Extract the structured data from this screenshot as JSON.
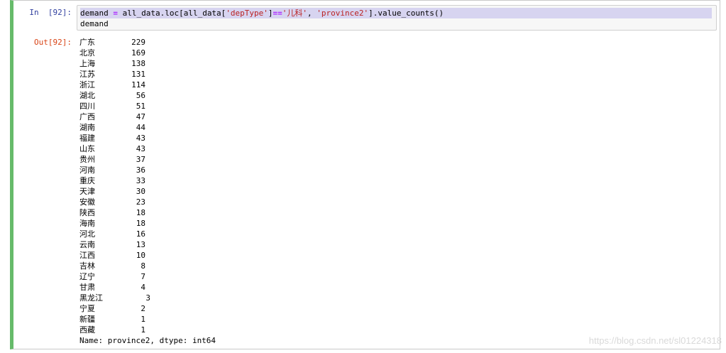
{
  "cell": {
    "in_prompt": "In  [92]:",
    "out_prompt": "Out[92]:",
    "code": {
      "line1_parts": [
        "demand ",
        "=",
        " all_data.loc[all_data[",
        "'depType'",
        "]",
        "==",
        "'儿科'",
        ", ",
        "'province2'",
        "].value_counts()"
      ],
      "line2": "demand"
    },
    "output": {
      "rows": [
        {
          "label": "广东",
          "count": "229"
        },
        {
          "label": "北京",
          "count": "169"
        },
        {
          "label": "上海",
          "count": "138"
        },
        {
          "label": "江苏",
          "count": "131"
        },
        {
          "label": "浙江",
          "count": "114"
        },
        {
          "label": "湖北",
          "count": "56"
        },
        {
          "label": "四川",
          "count": "51"
        },
        {
          "label": "广西",
          "count": "47"
        },
        {
          "label": "湖南",
          "count": "44"
        },
        {
          "label": "福建",
          "count": "43"
        },
        {
          "label": "山东",
          "count": "43"
        },
        {
          "label": "贵州",
          "count": "37"
        },
        {
          "label": "河南",
          "count": "36"
        },
        {
          "label": "重庆",
          "count": "33"
        },
        {
          "label": "天津",
          "count": "30"
        },
        {
          "label": "安徽",
          "count": "23"
        },
        {
          "label": "陕西",
          "count": "18"
        },
        {
          "label": "海南",
          "count": "18"
        },
        {
          "label": "河北",
          "count": "16"
        },
        {
          "label": "云南",
          "count": "13"
        },
        {
          "label": "江西",
          "count": "10"
        },
        {
          "label": "吉林",
          "count": "8"
        },
        {
          "label": "辽宁",
          "count": "7"
        },
        {
          "label": "甘肃",
          "count": "4"
        },
        {
          "label": "黑龙江",
          "count": "3"
        },
        {
          "label": "宁夏",
          "count": "2"
        },
        {
          "label": "新疆",
          "count": "1"
        },
        {
          "label": "西藏",
          "count": "1"
        }
      ],
      "dtype_line": "Name: province2, dtype: int64"
    }
  },
  "watermark": "https://blog.csdn.net/sl01224318",
  "colors": {
    "cell_border_accent": "#66bb6a",
    "in_prompt": "#303f9f",
    "out_prompt": "#d84315",
    "string_token": "#ba2121",
    "operator_token": "#aa22ff",
    "selection": "#d7d4f0"
  }
}
